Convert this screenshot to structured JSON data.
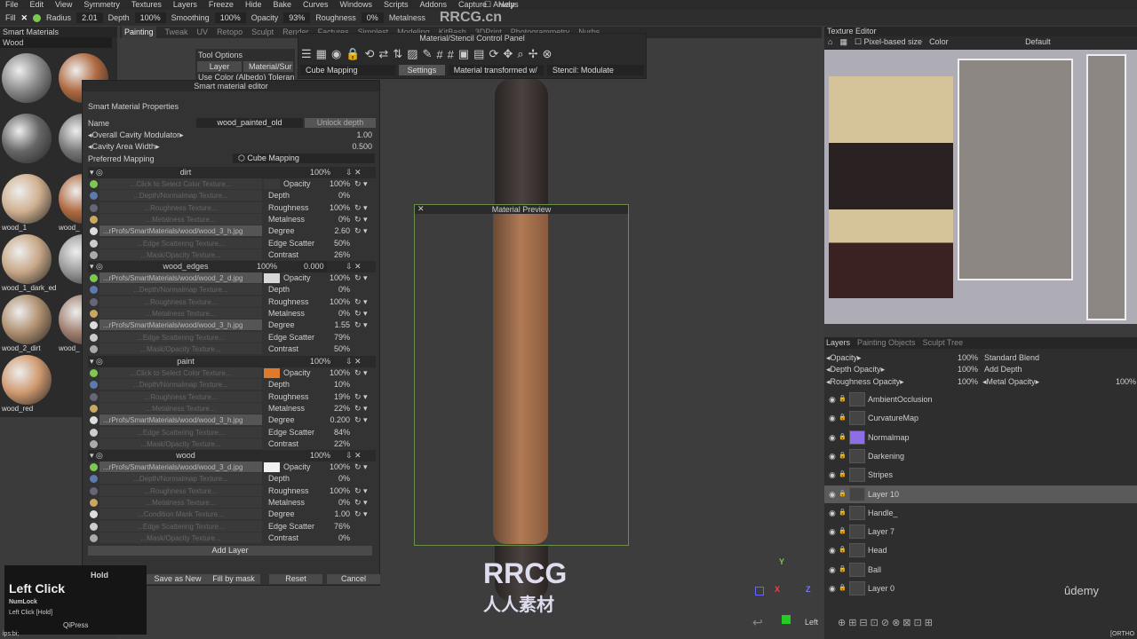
{
  "menu": [
    "File",
    "Edit",
    "View",
    "Symmetry",
    "Textures",
    "Layers",
    "Freeze",
    "Hide",
    "Bake",
    "Curves",
    "Windows",
    "Scripts",
    "Addons",
    "Capture",
    "Help"
  ],
  "always": "Always",
  "toolbar": {
    "fill": "Fill",
    "radius_label": "Radius",
    "radius": "2.01",
    "depth_label": "Depth",
    "depth": "100%",
    "smoothing_label": "Smoothing",
    "smoothing": "100%",
    "opacity_label": "Opacity",
    "opacity": "93%",
    "roughness_label": "Roughness",
    "roughness": "0%",
    "metalness_label": "Metalness"
  },
  "tabs": [
    "Painting",
    "Tweak",
    "UV",
    "Retopo",
    "Sculpt",
    "Render",
    "Factures",
    "Simplest",
    "Modeling",
    "KitBash",
    "3DPrint",
    "Photogrammetry",
    "Nurbs"
  ],
  "smart_materials": {
    "title": "Smart Materials",
    "search": "Wood",
    "items": [
      "wood_1",
      "wood_",
      "wood_1_dark_ed",
      "wood_2_dirt",
      "wood_",
      "wood_red"
    ]
  },
  "tool_options": {
    "title": "Tool Options",
    "tabs": [
      "Layer",
      "Material/Sur"
    ],
    "checkbox": "Use Color (Albedo) Toleran"
  },
  "mscp": {
    "title": "Material/Stencil Control Panel",
    "mapping": "Cube Mapping",
    "settings": "Settings",
    "transform": "Material transformed w/",
    "stencil": "Stencil: Modulate"
  },
  "editor": {
    "title": "Smart material editor",
    "section": "Smart Material Properties",
    "name_label": "Name",
    "name": "wood_painted_old",
    "unlock": "Unlock depth",
    "cavity_mod_label": "Overall Cavity Modulator",
    "cavity_mod": "1.00",
    "cavity_width_label": "Cavity Area Width",
    "cavity_width": "0.500",
    "mapping_label": "Preferred Mapping",
    "mapping": "Cube Mapping",
    "layers": [
      {
        "name": "dirt",
        "opacity": "100%",
        "extra": "",
        "swatch": "#3a3a3a",
        "rows": [
          [
            "...Click to Select Color Texture...",
            "Opacity",
            "100%"
          ],
          [
            "...Depth/Normalmap Texture...",
            "Depth",
            "0%"
          ],
          [
            "...Roughness Texture...",
            "Roughness",
            "100%"
          ],
          [
            "...Metalness Texture...",
            "Metalness",
            "0%"
          ],
          [
            "...rProfs/SmartMaterials/wood/wood_3_h.jpg",
            "Degree",
            "2.60"
          ],
          [
            "...Edge Scattering Texture...",
            "Edge Scatter",
            "50%"
          ],
          [
            "...Mask/Opacity Texture...",
            "Contrast",
            "26%"
          ]
        ]
      },
      {
        "name": "wood_edges",
        "opacity": "100%",
        "extra": "0.000",
        "swatch": "#d8d8d8",
        "rows": [
          [
            "...rProfs/SmartMaterials/wood/wood_2_d.jpg",
            "Opacity",
            "100%"
          ],
          [
            "...Depth/Normalmap Texture...",
            "Depth",
            "0%"
          ],
          [
            "...Roughness Texture...",
            "Roughness",
            "100%"
          ],
          [
            "...Metalness Texture...",
            "Metalness",
            "0%"
          ],
          [
            "...rProfs/SmartMaterials/wood/wood_3_h.jpg",
            "Degree",
            "1.55"
          ],
          [
            "...Edge Scattering Texture...",
            "Edge Scatter",
            "79%"
          ],
          [
            "...Mask/Opacity Texture...",
            "Contrast",
            "50%"
          ]
        ]
      },
      {
        "name": "paint",
        "opacity": "100%",
        "extra": "",
        "swatch": "#e07a2a",
        "rows": [
          [
            "...Click to Select Color Texture...",
            "Opacity",
            "100%"
          ],
          [
            "...Depth/Normalmap Texture...",
            "Depth",
            "10%"
          ],
          [
            "...Roughness Texture...",
            "Roughness",
            "19%"
          ],
          [
            "...Metalness Texture...",
            "Metalness",
            "22%"
          ],
          [
            "...rProfs/SmartMaterials/wood/wood_3_h.jpg",
            "Degree",
            "0.200"
          ],
          [
            "...Edge Scattering Texture...",
            "Edge Scatter",
            "84%"
          ],
          [
            "...Mask/Opacity Texture...",
            "Contrast",
            "22%"
          ]
        ]
      },
      {
        "name": "wood",
        "opacity": "100%",
        "extra": "",
        "swatch": "#f2f2f2",
        "rows": [
          [
            "...rProfs/SmartMaterials/wood/wood_3_d.jpg",
            "Opacity",
            "100%"
          ],
          [
            "...Depth/Normalmap Texture...",
            "Depth",
            "0%"
          ],
          [
            "...Roughness Texture...",
            "Roughness",
            "100%"
          ],
          [
            "...Metalness Texture...",
            "Metalness",
            "0%"
          ],
          [
            "...Condition Mask Texture...",
            "Degree",
            "1.00"
          ],
          [
            "...Edge Scattering Texture...",
            "Edge Scatter",
            "76%"
          ],
          [
            "...Mask/Opacity Texture...",
            "Contrast",
            "0%"
          ]
        ]
      }
    ],
    "add_layer": "Add Layer",
    "buttons": [
      "Save as New",
      "Fill by mask",
      "Reset",
      "Cancel"
    ]
  },
  "preview": {
    "title": "Material Preview"
  },
  "texture_editor": {
    "title": "Texture Editor",
    "pixel_based": "Pixel-based size",
    "channel": "Color",
    "preset": "Default"
  },
  "layers_panel": {
    "tabs": [
      "Layers",
      "Painting Objects",
      "Sculpt Tree"
    ],
    "opacity_label": "Opacity",
    "opacity": "100%",
    "blend": "Standard Blend",
    "depth_opacity_label": "Depth Opacity",
    "depth_opacity": "100%",
    "depth_mode": "Add Depth",
    "rough_label": "Roughness Opacity",
    "rough": "100%",
    "metal_label": "Metal Opacity",
    "metal": "100%",
    "items": [
      "AmbientOcclusion",
      "CurvatureMap",
      "Normalmap",
      "Darkening",
      "Stripes",
      "Layer 10",
      "Handle_",
      "Layer 7",
      "Head",
      "Ball",
      "Layer 0"
    ],
    "selected": "Layer 10"
  },
  "overlay": {
    "hold": "Hold",
    "title": "Left Click",
    "key": "NumLock",
    "desc": "Left Click [Hold]",
    "app": "QiPress"
  },
  "status": {
    "left": "ips:bi;",
    "right": "[ORTHO",
    "left_label": "Left",
    "udemy": "ûdemy",
    "watermark": "RRCG",
    "watermark_sub": "人人素材",
    "top_watermark": "RRCG.cn"
  },
  "colors": {
    "accent": "#8d6ee6",
    "selection": "#5a5a5a",
    "preview_border": "#6a8f4a"
  }
}
